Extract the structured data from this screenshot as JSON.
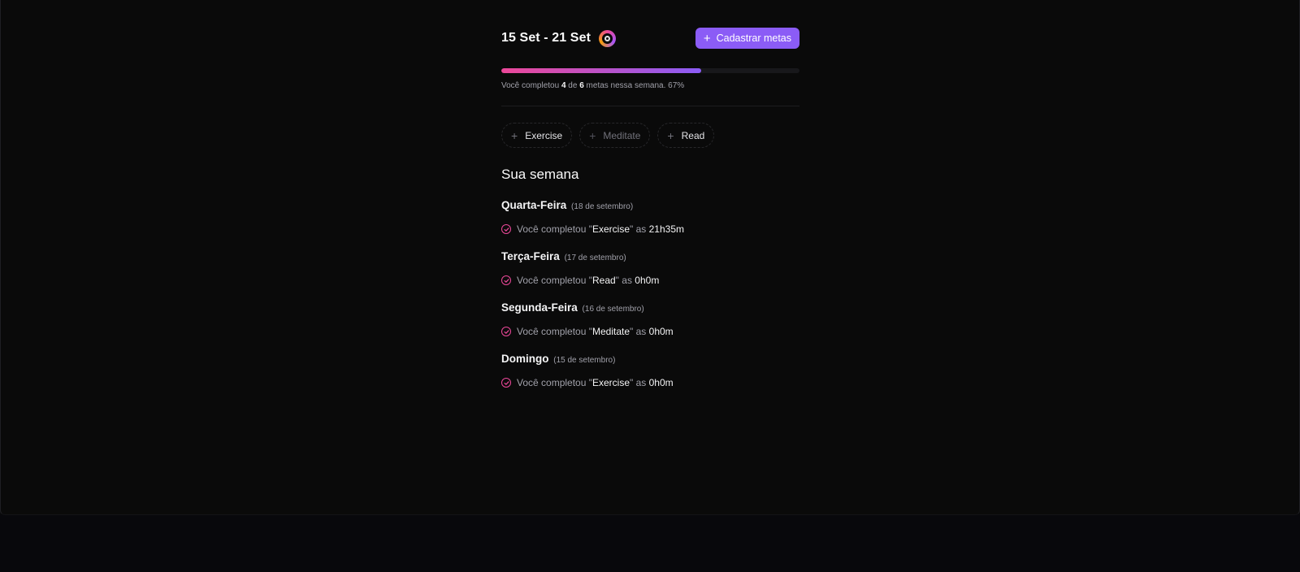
{
  "header": {
    "week_range": "15 Set - 21 Set",
    "add_button_label": "Cadastrar metas"
  },
  "progress": {
    "completed": "4",
    "total": "6",
    "fraction": 0.67,
    "text_prefix": "Você completou",
    "text_of": "de",
    "text_suffix": "metas nessa semana.",
    "percent_label": "67%"
  },
  "pending_goals": [
    {
      "label": "Exercise",
      "disabled": false
    },
    {
      "label": "Meditate",
      "disabled": true
    },
    {
      "label": "Read",
      "disabled": false
    }
  ],
  "summary": {
    "title": "Sua semana",
    "entry_prefix": "Você completou",
    "entry_at": "as",
    "days": [
      {
        "weekday": "Quarta-Feira",
        "date": "(18 de setembro)",
        "goal": "Exercise",
        "time": "21h35m"
      },
      {
        "weekday": "Terça-Feira",
        "date": "(17 de setembro)",
        "goal": "Read",
        "time": "0h0m"
      },
      {
        "weekday": "Segunda-Feira",
        "date": "(16 de setembro)",
        "goal": "Meditate",
        "time": "0h0m"
      },
      {
        "weekday": "Domingo",
        "date": "(15 de setembro)",
        "goal": "Exercise",
        "time": "0h0m"
      }
    ]
  },
  "colors": {
    "accent": "#8b5cf6",
    "pink": "#ec4899",
    "background": "#0a0a0a"
  },
  "icons": {
    "logo": "target-logo-icon",
    "plus": "plus-icon",
    "check": "check-circle-icon"
  }
}
